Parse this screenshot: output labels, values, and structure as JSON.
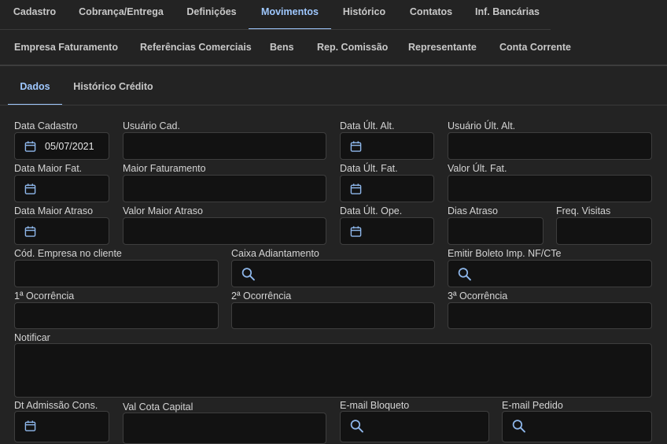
{
  "main_tabs": [
    "Cadastro",
    "Cobrança/Entrega",
    "Definições",
    "Movimentos",
    "Histórico",
    "Contatos",
    "Inf. Bancárias"
  ],
  "sub_tabs": [
    "Empresa Faturamento",
    "Referências Comerciais",
    "Bens",
    "Rep. Comissão",
    "Representante",
    "Conta Corrente"
  ],
  "inner_tabs": [
    "Dados",
    "Histórico Crédito"
  ],
  "labels": {
    "data_cadastro": "Data Cadastro",
    "usuario_cad": "Usuário Cad.",
    "data_ult_alt": "Data Últ. Alt.",
    "usuario_ult_alt": "Usuário Últ. Alt.",
    "data_maior_fat": "Data Maior Fat.",
    "maior_faturamento": "Maior Faturamento",
    "data_ult_fat": "Data Últ. Fat.",
    "valor_ult_fat": "Valor Últ. Fat.",
    "data_maior_atraso": "Data Maior Atraso",
    "valor_maior_atraso": "Valor Maior Atraso",
    "data_ult_ope": "Data Últ. Ope.",
    "dias_atraso": "Dias Atraso",
    "freq_visitas": "Freq. Visitas",
    "cod_empresa": "Cód. Empresa no cliente",
    "caixa_adiantamento": "Caixa Adiantamento",
    "emitir_boleto": "Emitir Boleto Imp. NF/CTe",
    "ocorrencia1": "1ª Ocorrência",
    "ocorrencia2": "2ª Ocorrência",
    "ocorrencia3": "3ª Ocorrência",
    "notificar": "Notificar",
    "dt_admissao": "Dt Admissão Cons.",
    "val_cota": "Val Cota Capital",
    "email_bloqueto": "E-mail Bloqueto",
    "email_pedido": "E-mail Pedido"
  },
  "values": {
    "data_cadastro": "05/07/2021"
  },
  "colors": {
    "accent": "#9fc8ff",
    "background": "#232323",
    "field": "#121212"
  }
}
